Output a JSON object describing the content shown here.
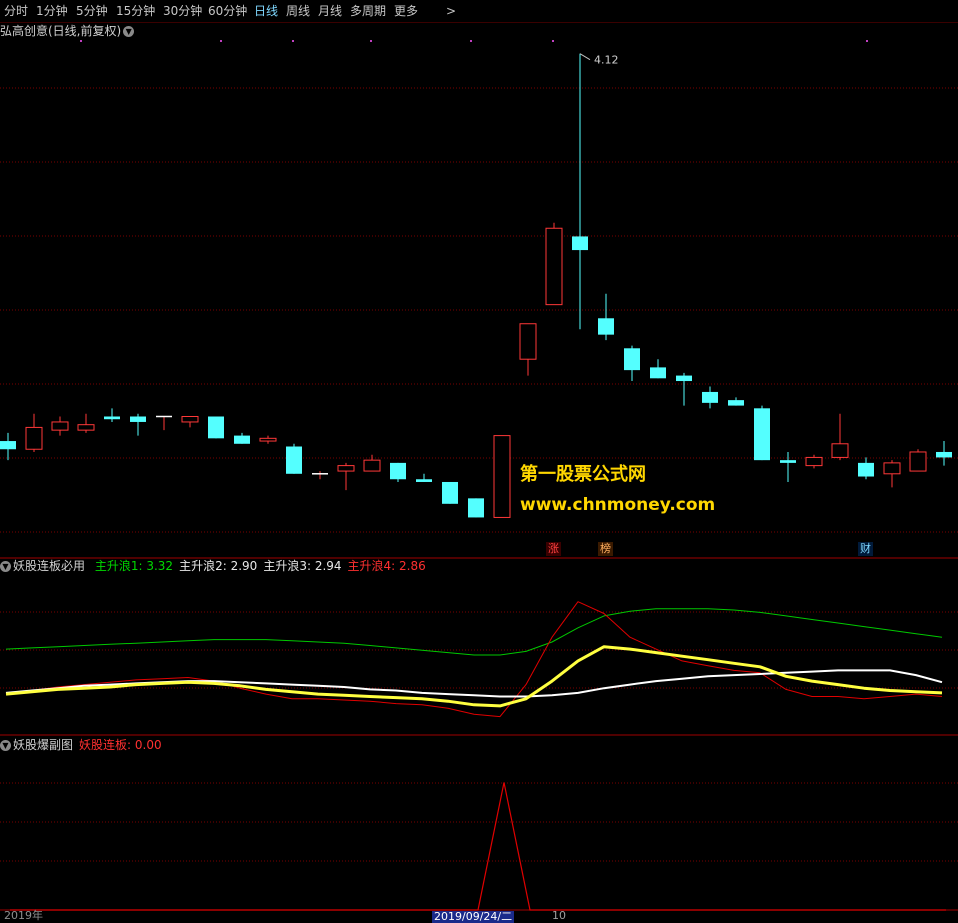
{
  "toolbar": {
    "items": [
      "分时",
      "1分钟",
      "5分钟",
      "15分钟",
      "30分钟",
      "60分钟",
      "日线",
      "周线",
      "月线",
      "多周期",
      "更多"
    ],
    "active": "日线",
    "more_arrow": ">"
  },
  "main_panel": {
    "title": "弘高创意(日线,前复权)",
    "peak_label": "4.12",
    "watermark_line1": "第一股票公式网",
    "watermark_line2": "www.chnmoney.com",
    "event_badges": [
      "涨",
      "榜",
      "财"
    ]
  },
  "indicator_panel": {
    "title": "妖股连板必用",
    "lines": [
      {
        "label": "主升浪1:",
        "value": "3.32",
        "color": "#00d800"
      },
      {
        "label": "主升浪2:",
        "value": "2.90",
        "color": "#e8e8e8"
      },
      {
        "label": "主升浪3:",
        "value": "2.94",
        "color": "#e8e8e8"
      },
      {
        "label": "主升浪4:",
        "value": "2.86",
        "color": "#ff3030"
      }
    ]
  },
  "sub_panel": {
    "title": "妖股爆副图",
    "line_label": "妖股连板:",
    "line_value": "0.00"
  },
  "footer": {
    "left_date": "2019年",
    "cursor_date": "2019/09/24/二",
    "right_label": "10"
  },
  "colors": {
    "up": "#ff3838",
    "down": "#54ffff",
    "grid": "#7a0000",
    "yellow_line": "#ffff40",
    "white_line": "#ffffff",
    "green_line": "#00c800",
    "red_line": "#e00000"
  },
  "chart_data": [
    {
      "type": "candlestick",
      "title": "弘高创意(日线,前复权)",
      "candles": [
        {
          "o": 2.7,
          "h": 2.73,
          "l": 2.63,
          "c": 2.67
        },
        {
          "o": 2.67,
          "h": 2.8,
          "l": 2.66,
          "c": 2.75
        },
        {
          "o": 2.74,
          "h": 2.79,
          "l": 2.72,
          "c": 2.77
        },
        {
          "o": 2.74,
          "h": 2.8,
          "l": 2.73,
          "c": 2.76
        },
        {
          "o": 2.79,
          "h": 2.82,
          "l": 2.77,
          "c": 2.78
        },
        {
          "o": 2.79,
          "h": 2.8,
          "l": 2.72,
          "c": 2.77
        },
        {
          "o": 2.79,
          "h": 2.79,
          "l": 2.74,
          "c": 2.79
        },
        {
          "o": 2.77,
          "h": 2.79,
          "l": 2.75,
          "c": 2.79
        },
        {
          "o": 2.79,
          "h": 2.79,
          "l": 2.71,
          "c": 2.71
        },
        {
          "o": 2.72,
          "h": 2.73,
          "l": 2.69,
          "c": 2.69
        },
        {
          "o": 2.7,
          "h": 2.72,
          "l": 2.69,
          "c": 2.71
        },
        {
          "o": 2.68,
          "h": 2.69,
          "l": 2.58,
          "c": 2.58
        },
        {
          "o": 2.58,
          "h": 2.59,
          "l": 2.56,
          "c": 2.58
        },
        {
          "o": 2.59,
          "h": 2.62,
          "l": 2.52,
          "c": 2.61
        },
        {
          "o": 2.59,
          "h": 2.65,
          "l": 2.59,
          "c": 2.63
        },
        {
          "o": 2.62,
          "h": 2.62,
          "l": 2.55,
          "c": 2.56
        },
        {
          "o": 2.56,
          "h": 2.58,
          "l": 2.55,
          "c": 2.55
        },
        {
          "o": 2.55,
          "h": 2.55,
          "l": 2.47,
          "c": 2.47
        },
        {
          "o": 2.49,
          "h": 2.49,
          "l": 2.42,
          "c": 2.42
        },
        {
          "o": 2.42,
          "h": 2.72,
          "l": 2.42,
          "c": 2.72
        },
        {
          "o": 3.0,
          "h": 3.13,
          "l": 2.94,
          "c": 3.13
        },
        {
          "o": 3.2,
          "h": 3.5,
          "l": 3.33,
          "c": 3.48
        },
        {
          "o": 3.45,
          "h": 4.12,
          "l": 3.11,
          "c": 3.4
        },
        {
          "o": 3.15,
          "h": 3.24,
          "l": 3.07,
          "c": 3.09
        },
        {
          "o": 3.04,
          "h": 3.05,
          "l": 2.92,
          "c": 2.96
        },
        {
          "o": 2.97,
          "h": 3.0,
          "l": 2.93,
          "c": 2.93
        },
        {
          "o": 2.94,
          "h": 2.95,
          "l": 2.83,
          "c": 2.92
        },
        {
          "o": 2.88,
          "h": 2.9,
          "l": 2.82,
          "c": 2.84
        },
        {
          "o": 2.85,
          "h": 2.86,
          "l": 2.83,
          "c": 2.83
        },
        {
          "o": 2.82,
          "h": 2.83,
          "l": 2.63,
          "c": 2.63
        },
        {
          "o": 2.63,
          "h": 2.66,
          "l": 2.55,
          "c": 2.62
        },
        {
          "o": 2.61,
          "h": 2.65,
          "l": 2.6,
          "c": 2.64
        },
        {
          "o": 2.64,
          "h": 2.8,
          "l": 2.63,
          "c": 2.69
        },
        {
          "o": 2.62,
          "h": 2.64,
          "l": 2.56,
          "c": 2.57
        },
        {
          "o": 2.58,
          "h": 2.63,
          "l": 2.53,
          "c": 2.62
        },
        {
          "o": 2.59,
          "h": 2.67,
          "l": 2.59,
          "c": 2.66
        },
        {
          "o": 2.66,
          "h": 2.7,
          "l": 2.61,
          "c": 2.64
        }
      ],
      "ylim": [
        2.33,
        4.17
      ]
    },
    {
      "type": "line",
      "title": "妖股连板必用",
      "series": [
        {
          "name": "主升浪1",
          "values": [
            3.1,
            3.11,
            3.12,
            3.13,
            3.14,
            3.15,
            3.16,
            3.17,
            3.18,
            3.18,
            3.18,
            3.17,
            3.16,
            3.15,
            3.13,
            3.11,
            3.09,
            3.07,
            3.05,
            3.05,
            3.08,
            3.16,
            3.28,
            3.38,
            3.42,
            3.44,
            3.44,
            3.44,
            3.43,
            3.41,
            3.38,
            3.35,
            3.32,
            3.29,
            3.26,
            3.23,
            3.2
          ]
        },
        {
          "name": "主升浪2",
          "values": [
            2.73,
            2.75,
            2.77,
            2.79,
            2.8,
            2.81,
            2.82,
            2.83,
            2.83,
            2.82,
            2.81,
            2.8,
            2.79,
            2.78,
            2.76,
            2.75,
            2.73,
            2.72,
            2.71,
            2.7,
            2.7,
            2.71,
            2.73,
            2.77,
            2.8,
            2.83,
            2.85,
            2.87,
            2.88,
            2.89,
            2.9,
            2.91,
            2.92,
            2.92,
            2.92,
            2.88,
            2.82
          ]
        },
        {
          "name": "主升浪3",
          "values": [
            2.72,
            2.74,
            2.76,
            2.77,
            2.78,
            2.8,
            2.81,
            2.82,
            2.81,
            2.79,
            2.76,
            2.74,
            2.72,
            2.71,
            2.7,
            2.69,
            2.68,
            2.66,
            2.63,
            2.62,
            2.68,
            2.83,
            3.0,
            3.12,
            3.1,
            3.07,
            3.04,
            3.01,
            2.98,
            2.95,
            2.87,
            2.83,
            2.8,
            2.77,
            2.75,
            2.74,
            2.73
          ]
        },
        {
          "name": "主升浪4",
          "values": [
            2.72,
            2.75,
            2.78,
            2.8,
            2.82,
            2.84,
            2.85,
            2.86,
            2.83,
            2.77,
            2.72,
            2.68,
            2.68,
            2.67,
            2.66,
            2.64,
            2.63,
            2.6,
            2.55,
            2.53,
            2.8,
            3.2,
            3.5,
            3.4,
            3.2,
            3.1,
            3.0,
            2.96,
            2.92,
            2.9,
            2.76,
            2.7,
            2.7,
            2.68,
            2.7,
            2.72,
            2.7
          ]
        }
      ],
      "ylim": [
        2.4,
        3.7
      ]
    },
    {
      "type": "line",
      "title": "妖股爆副图",
      "series": [
        {
          "name": "妖股连板",
          "values": [
            0,
            0,
            0,
            0,
            0,
            0,
            0,
            0,
            0,
            0,
            0,
            0,
            0,
            0,
            0,
            0,
            0,
            0,
            0,
            1,
            0,
            0,
            0,
            0,
            0,
            0,
            0,
            0,
            0,
            0,
            0,
            0,
            0,
            0,
            0,
            0,
            0
          ]
        }
      ],
      "ylim": [
        0,
        1.2
      ]
    }
  ]
}
